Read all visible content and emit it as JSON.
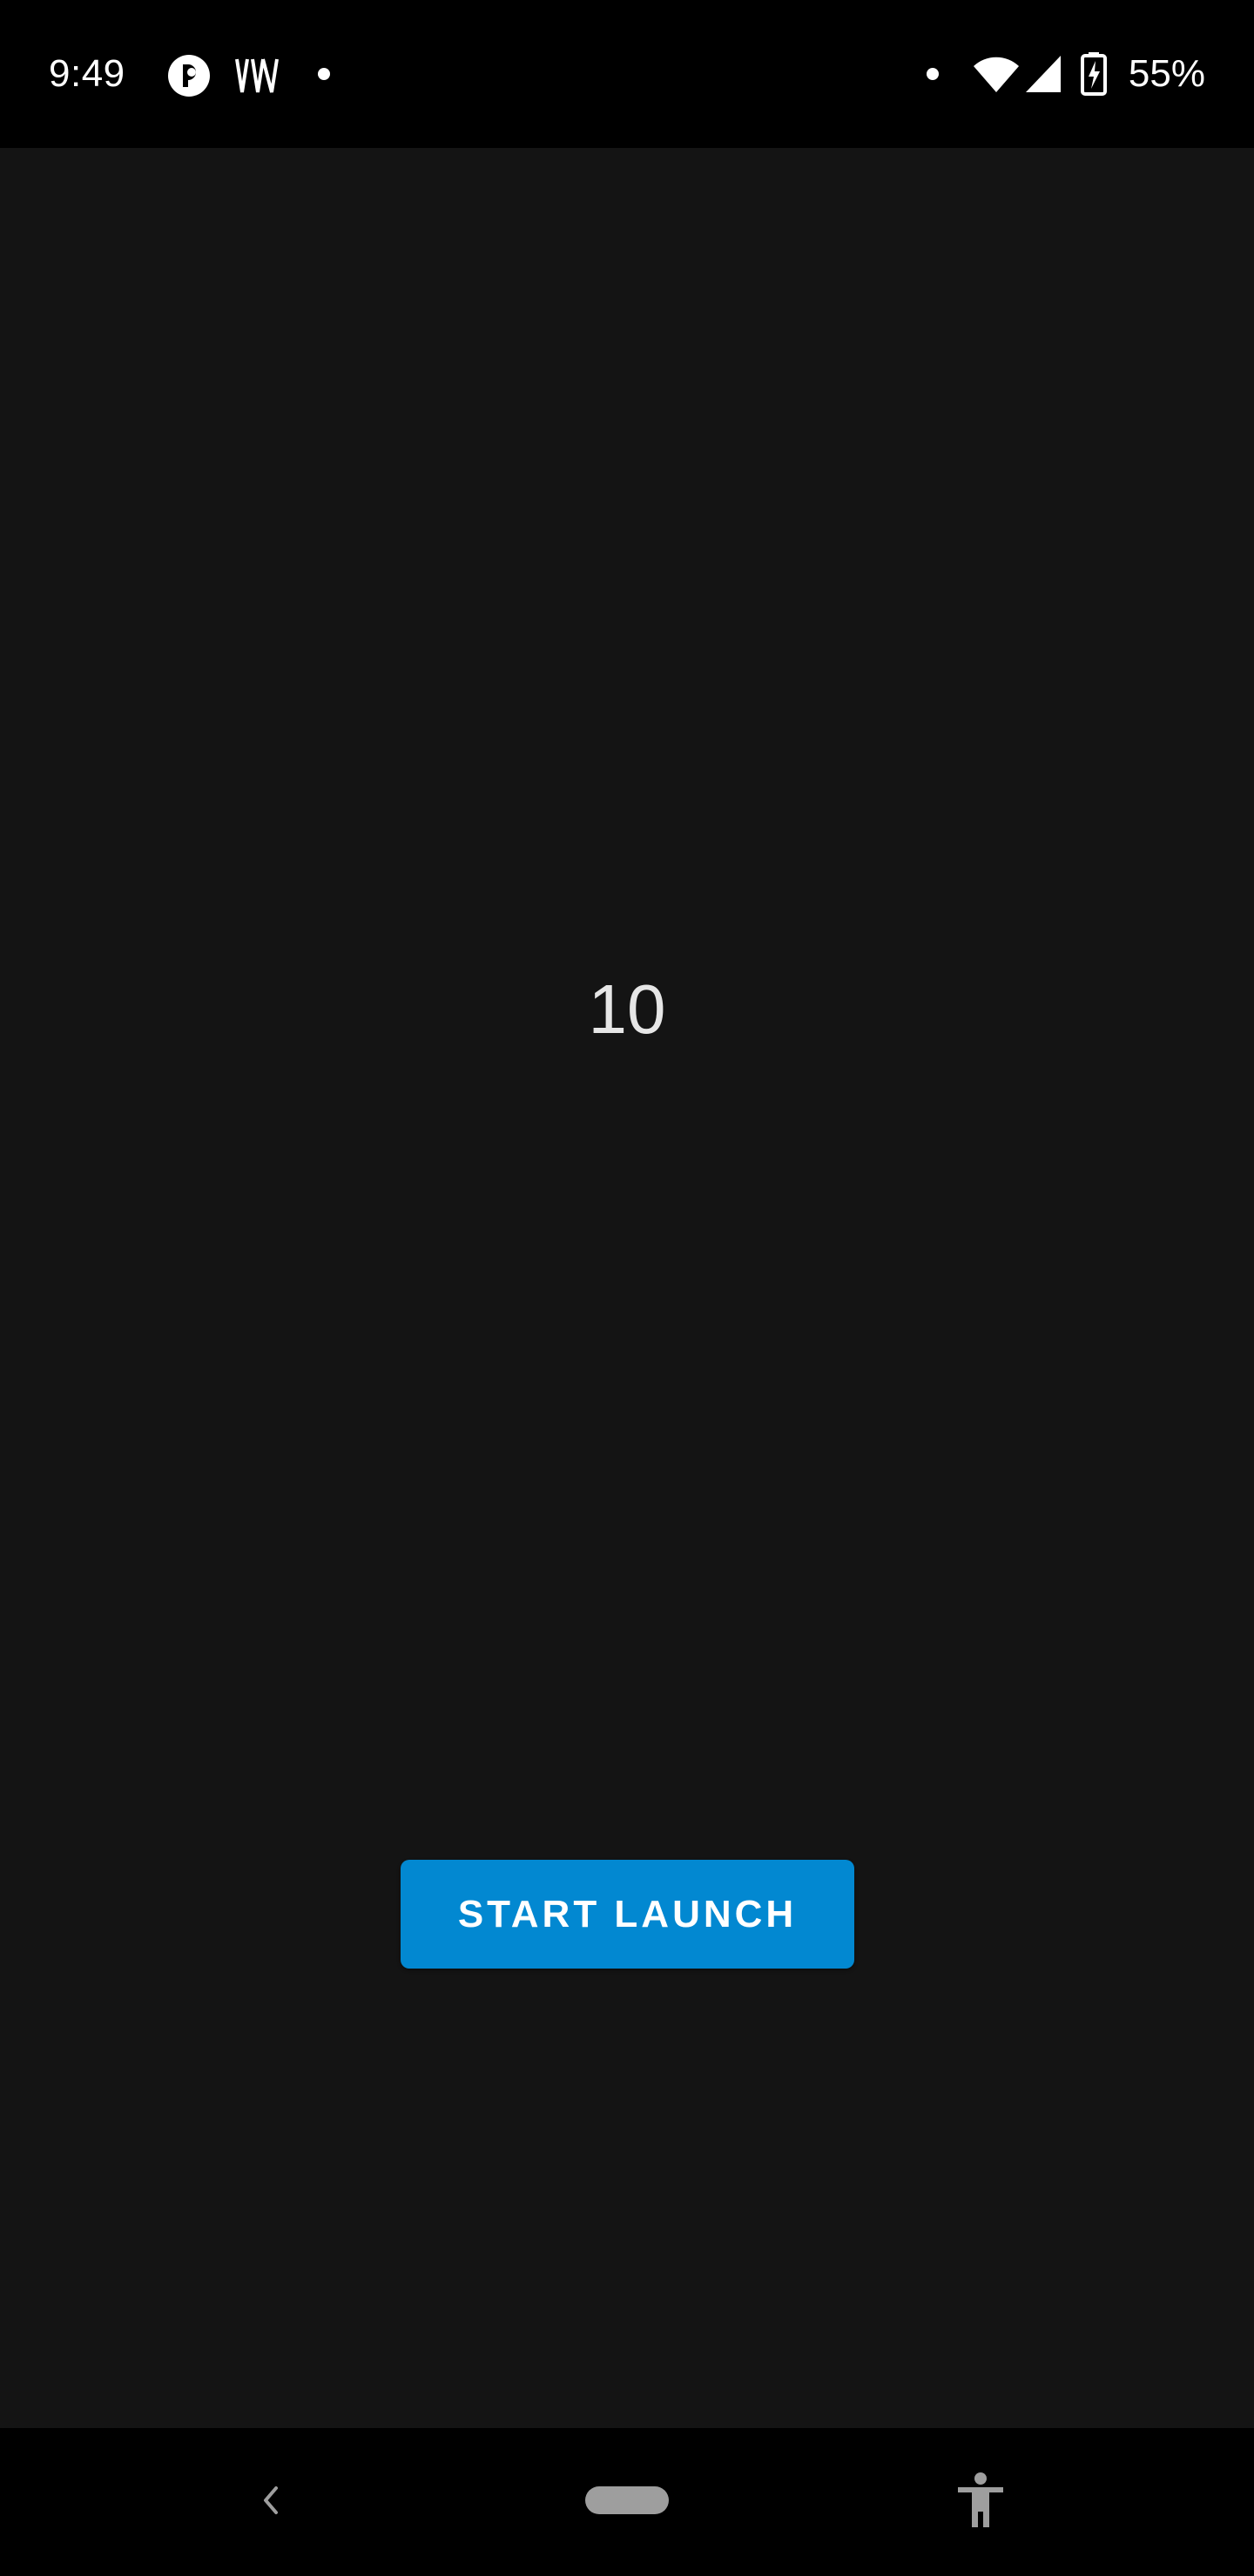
{
  "status_bar": {
    "time": "9:49",
    "battery_percent": "55%",
    "icons": [
      "app-notification-icon",
      "wave-notification-icon",
      "notification-dot-icon",
      "dot-icon",
      "wifi-icon",
      "cellular-signal-icon",
      "battery-charging-icon"
    ]
  },
  "main": {
    "counter_value": "10",
    "launch_button_label": "START LAUNCH"
  },
  "navigation": {
    "items": [
      "back-icon",
      "home-pill-icon",
      "accessibility-icon"
    ]
  },
  "colors": {
    "background": "#141414",
    "status_bar": "#000000",
    "button": "#0288d1",
    "text_primary": "#e6e6e6"
  }
}
